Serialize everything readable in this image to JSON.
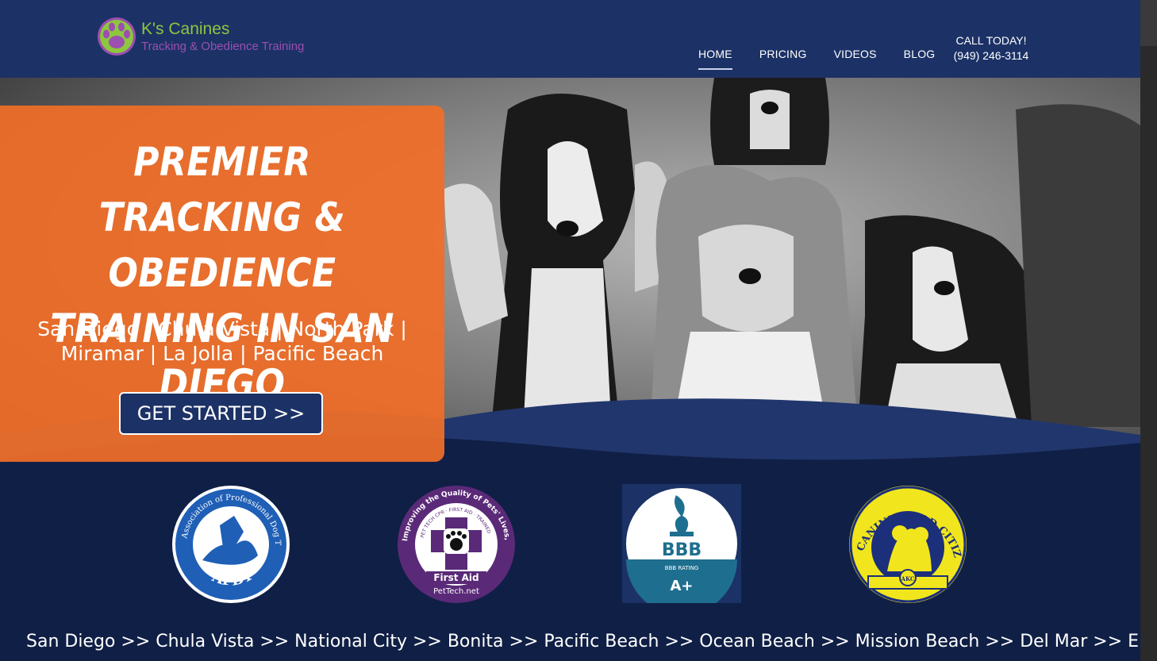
{
  "brand": {
    "name": "K's Canines",
    "tagline": "Tracking & Obedience Training",
    "colors": {
      "header": "#1c3266",
      "accent_orange": "#f06e28",
      "logo_green": "#8dc63f",
      "logo_purple": "#9b4fb0"
    }
  },
  "nav": {
    "items": [
      {
        "label": "HOME",
        "active": true
      },
      {
        "label": "PRICING",
        "active": false
      },
      {
        "label": "VIDEOS",
        "active": false
      },
      {
        "label": "BLOG",
        "active": false
      }
    ],
    "call_label": "CALL TODAY!",
    "phone": "(949) 246-3114"
  },
  "hero": {
    "title": "Premier Tracking & Obedience Training in San Diego",
    "cities_line1": "San Diego | Chula Vista | North Park |",
    "cities_line2": "Miramar | La Jolla | Pacific Beach",
    "cta_label": "GET STARTED >>"
  },
  "badges": {
    "apdt": {
      "top_text": "Association of Professional Dog Trainers",
      "bottom_text": "APDT"
    },
    "pettech": {
      "ring_text": "Improving the Quality of Pets' Lives, One Pet Parent at a Time.",
      "inner_text": "PET TECH CPR · FIRST AID · TRAINED",
      "label": "First Aid",
      "site": "PetTech.net"
    },
    "bbb": {
      "logo": "BBB",
      "rating_label": "BBB RATING",
      "rating": "A+"
    },
    "cgc": {
      "text": "CANINE GOOD CITIZEN",
      "seal": "AKC"
    }
  },
  "ticker": {
    "text": "San Diego >> Chula Vista >> National City >> Bonita >> Pacific Beach >> Ocean Beach >> Mission Beach >> Del Mar >> El Cajon >> Jamul >> S"
  }
}
